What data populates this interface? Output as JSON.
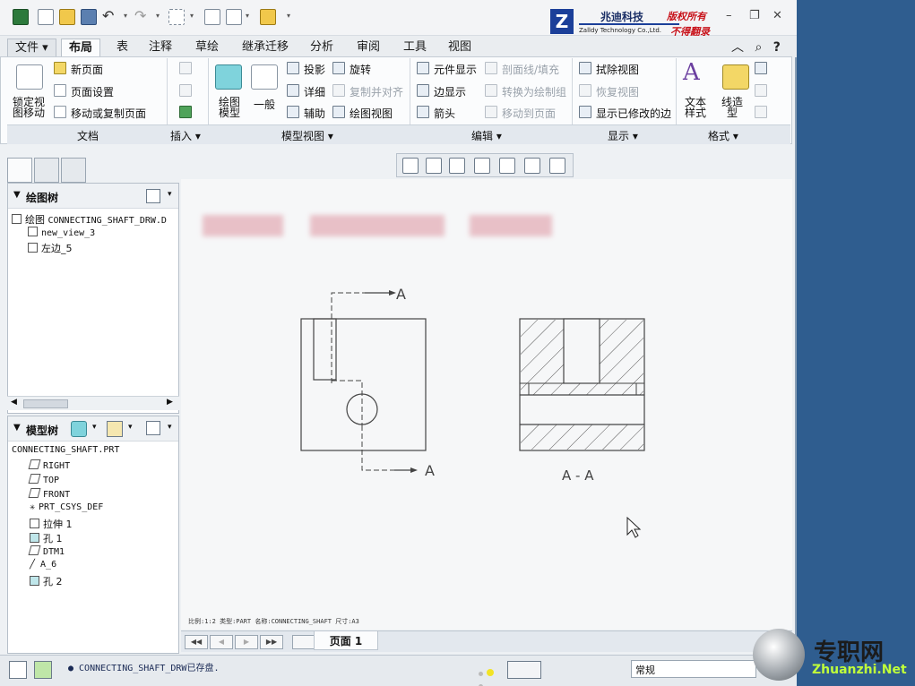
{
  "quick_access": {
    "title": "Creo Parametric quick access toolbar"
  },
  "logo": {
    "mark": "Z",
    "name": "兆迪科技",
    "en": "Zalldy Technology Co.,Ltd.",
    "right1": "版权所有",
    "right2": "不得翻录"
  },
  "window": {
    "minimize": "–",
    "restore": "❐",
    "close": "✕"
  },
  "tabs": {
    "file": "文件 ▾",
    "items": [
      "布局",
      "表",
      "注释",
      "草绘",
      "继承迁移",
      "分析",
      "审阅",
      "工具",
      "视图"
    ]
  },
  "ribbon": {
    "doc": {
      "lock": "锁定视\n图移动",
      "new_page": "新页面",
      "page_setup": "页面设置",
      "move_copy": "移动或复制页面"
    },
    "model_view": {
      "draw_model": "绘图\n模型",
      "general": "一般",
      "projection": "投影",
      "detail": "详细",
      "auxiliary": "辅助",
      "rotate": "旋转",
      "copy_align": "复制并对齐",
      "drawing_view": "绘图视图"
    },
    "edit": {
      "component_display": "元件显示",
      "edge_display": "边显示",
      "arrow": "箭头",
      "section_fill": "剖面线/填充",
      "convert_group": "转换为绘制组",
      "move_to_page": "移动到页面"
    },
    "display": {
      "erase_view": "拭除视图",
      "restore_view": "恢复视图",
      "show_modified_edges": "显示已修改的边"
    },
    "format": {
      "text_style": "文本\n样式",
      "line_style": "线造\n型"
    }
  },
  "groups": {
    "doc": "文档",
    "insert": "插入 ▾",
    "model_view": "模型视图 ▾",
    "edit": "编辑 ▾",
    "display": "显示 ▾",
    "format": "格式 ▾"
  },
  "drawing_tree": {
    "title": "绘图树",
    "root_label": "绘图",
    "root_file": "CONNECTING_SHAFT_DRW.D",
    "items": [
      "new_view_3",
      "左边_5"
    ]
  },
  "model_tree": {
    "title": "模型树",
    "root": "CONNECTING_SHAFT.PRT",
    "items": [
      "RIGHT",
      "TOP",
      "FRONT",
      "PRT_CSYS_DEF",
      "拉伸 1",
      "孔 1",
      "DTM1",
      "A_6",
      "孔 2"
    ]
  },
  "drawing": {
    "section_label": "A",
    "section_view_label": "A - A"
  },
  "footer_info": "比例:1:2   类型:PART   名称:CONNECTING_SHAFT   尺寸:A3",
  "pagebar": {
    "first": "◀◀",
    "prev": "◀",
    "next": "▶",
    "last": "▶▶",
    "page_label": "页面 1"
  },
  "status": {
    "message": "● CONNECTING_SHAFT_DRW已存盘.",
    "filter": "常规"
  },
  "watermark": {
    "cn": "专职网",
    "en": "Zhuanzhi.Net"
  }
}
